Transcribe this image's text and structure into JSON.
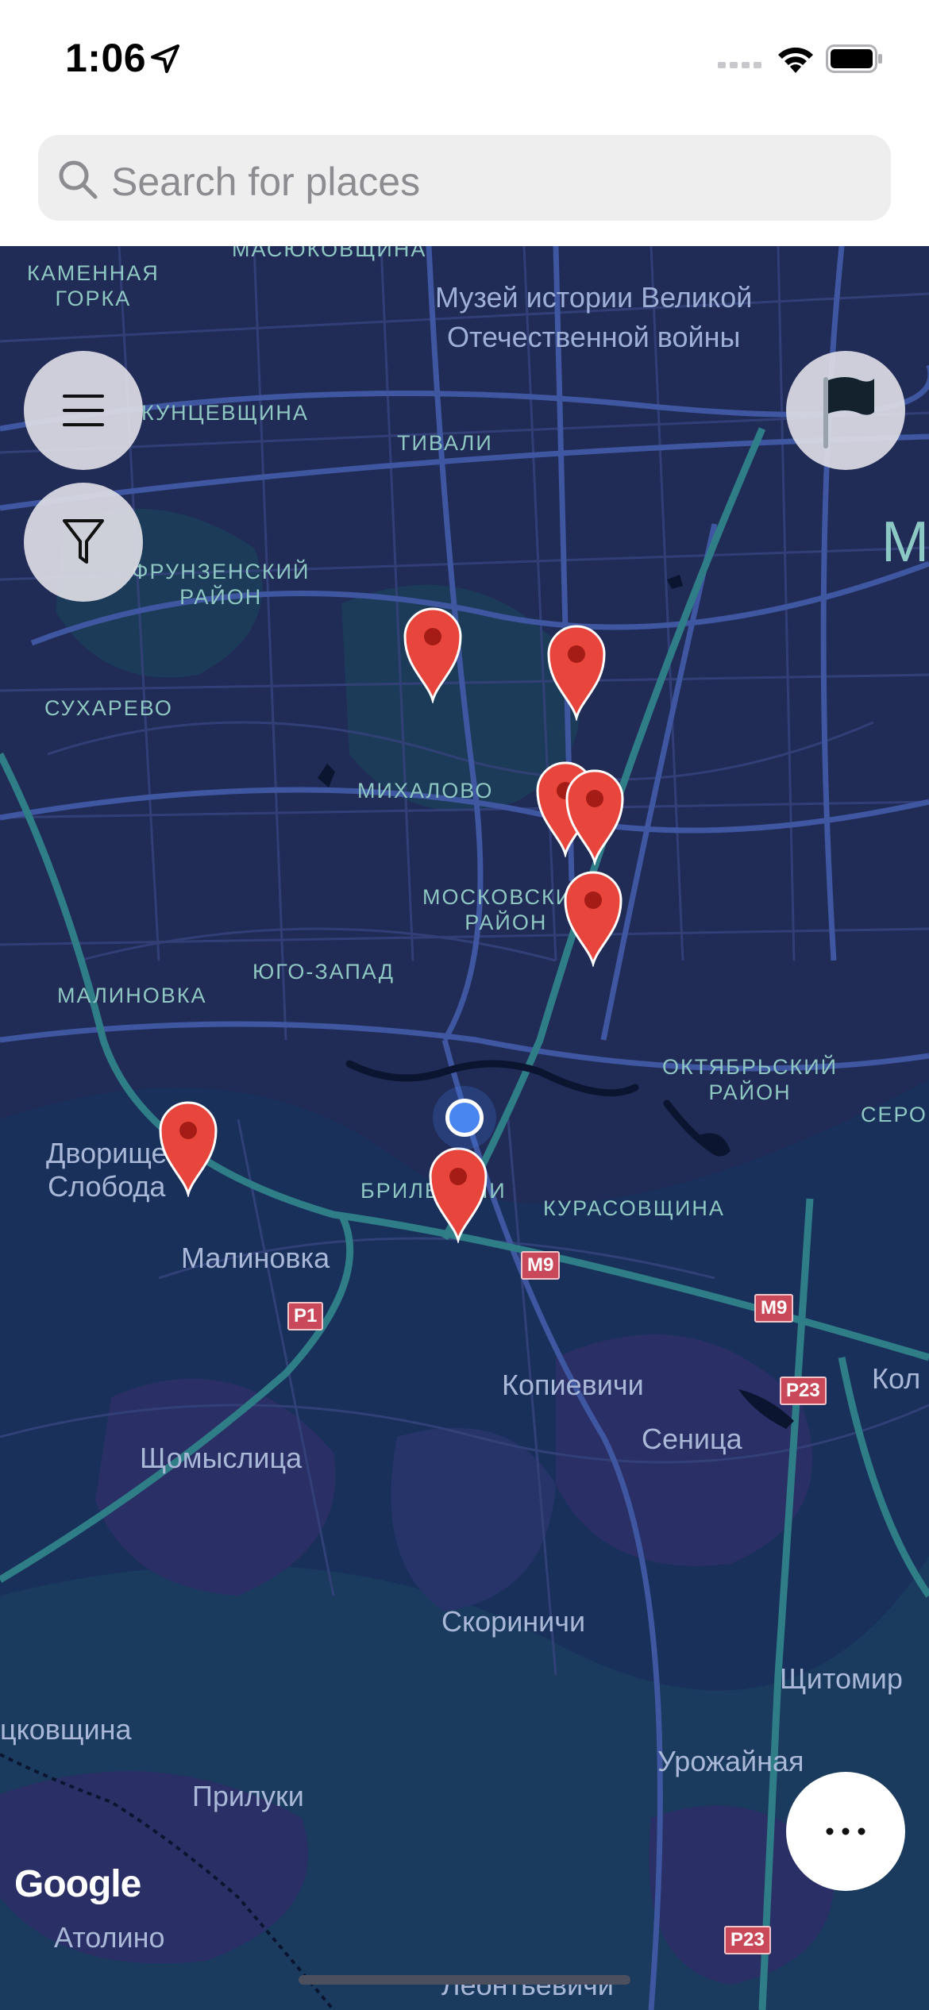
{
  "status_bar": {
    "time": "1:06"
  },
  "search": {
    "placeholder": "Search for places"
  },
  "map": {
    "labels": {
      "masyukovshchina": "МАСЮКОВЩИНА",
      "kamennaya_gorka": "КАМЕННАЯ\nГОРКА",
      "museum": "Музей истории Великой\nОтечественной войны",
      "kuntsevshchina": "КУНЦЕВЩИНА",
      "tivali": "ТИВАЛИ",
      "frunzensky": "ФРУНЗЕНСКИЙ\nРАЙОН",
      "sukharevo": "СУХАРЕВО",
      "mikhalovo": "МИХАЛОВО",
      "moskovsky": "МОСКОВСКИЙ\nРАЙОН",
      "yugo_zapad": "ЮГО-ЗАПАД",
      "malinovka_district": "МАЛИНОВКА",
      "oktyabrsky": "ОКТЯБРЬСКИЙ\nРАЙОН",
      "sero": "СЕРО",
      "dvorishche": "Дворище\nСлобода",
      "brilevichi": "БРИЛЕВИЧИ",
      "kurasovshchina": "КУРАСОВЩИНА",
      "malinovka": "Малиновка",
      "kopievichi": "Копиевичи",
      "kol": "Кол",
      "senitsa": "Сеница",
      "shchomyslitsa": "Щомыслица",
      "skorinichi": "Скориничи",
      "shchitomir": "Щитомир",
      "tskovshchina": "цковщина",
      "urozhaynaya": "Урожайная",
      "priluki": "Прилуки",
      "atolino": "Атолино",
      "leontyevichi": "Леонтьевичи",
      "big_m": "М"
    },
    "roads": [
      "M9",
      "M9",
      "P1",
      "P23",
      "P23"
    ],
    "attribution": "Google",
    "marker_color": "#e8453c",
    "user_location_color": "#4a86f0"
  },
  "controls": {
    "menu": "menu-icon",
    "filter": "filter-icon",
    "flag": "flag-icon",
    "more": "more-icon"
  }
}
